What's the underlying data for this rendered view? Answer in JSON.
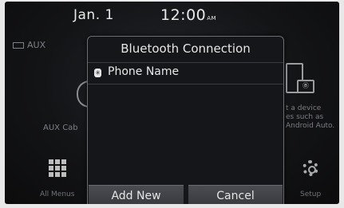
{
  "status": {
    "date": "Jan. 1",
    "time": "12:00",
    "ampm": "AM"
  },
  "background": {
    "aux_top": "AUX",
    "aux_cable": "AUX Cab",
    "all_menus": "All Menus",
    "setup": "Setup",
    "phone_lines": [
      "t a device",
      "es such as",
      "Android Auto."
    ]
  },
  "dialog": {
    "title": "Bluetooth Connection",
    "device_name": "Phone Name",
    "add_new": "Add New",
    "cancel": "Cancel"
  }
}
